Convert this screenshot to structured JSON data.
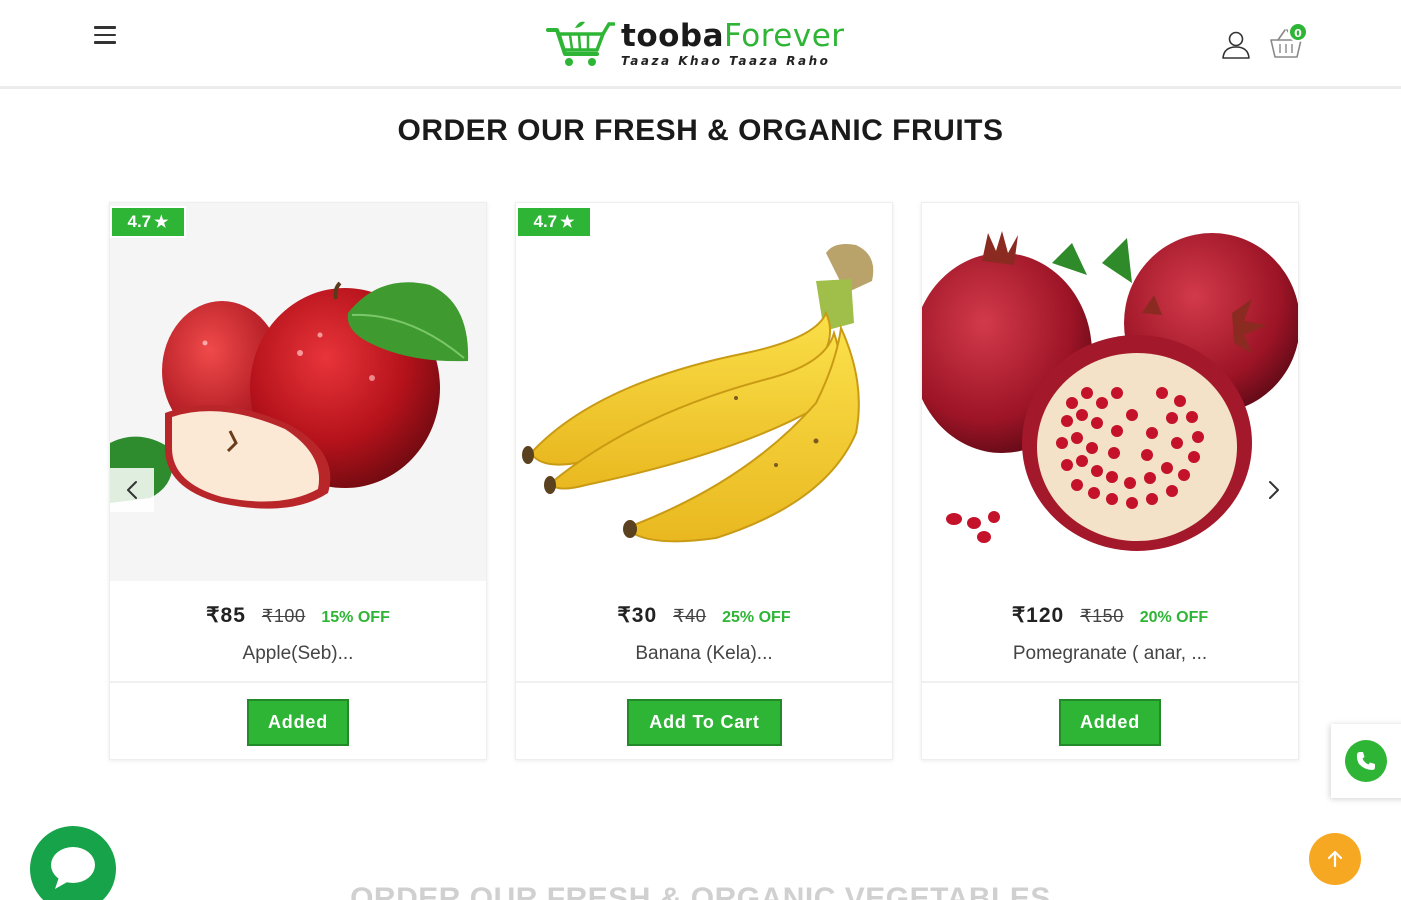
{
  "header": {
    "logo_main_part1": "tooba",
    "logo_main_part2": "Forever",
    "logo_tagline": "Taaza Khao Taaza Raho",
    "cart_count": "0",
    "brand_color": "#2fb536"
  },
  "icons": {
    "menu": "hamburger-menu-icon",
    "user": "user-icon",
    "cart": "shopping-basket-icon",
    "prev": "chevron-left-icon",
    "next": "chevron-right-icon",
    "phone": "phone-icon",
    "chat": "chat-bubble-icon",
    "scroll_top": "arrow-up-icon"
  },
  "section": {
    "title": "ORDER OUR FRESH & ORGANIC FRUITS",
    "next_title": "ORDER OUR FRESH & ORGANIC VEGETABLES"
  },
  "products": [
    {
      "rating": "4.7",
      "price": "₹85",
      "mrp": "₹100",
      "discount": "15% OFF",
      "name": "Apple(Seb)...",
      "button": "Added",
      "image": "apple"
    },
    {
      "rating": "4.7",
      "price": "₹30",
      "mrp": "₹40",
      "discount": "25% OFF",
      "name": "Banana (Kela)...",
      "button": "Add To Cart",
      "image": "banana"
    },
    {
      "price": "₹120",
      "mrp": "₹150",
      "discount": "20% OFF",
      "name": "Pomegranate ( anar, ...",
      "button": "Added",
      "image": "pomegranate"
    }
  ],
  "colors": {
    "accent_green": "#2fb536",
    "chat_green": "#16a34a",
    "scroll_top_orange": "#f7a823"
  }
}
